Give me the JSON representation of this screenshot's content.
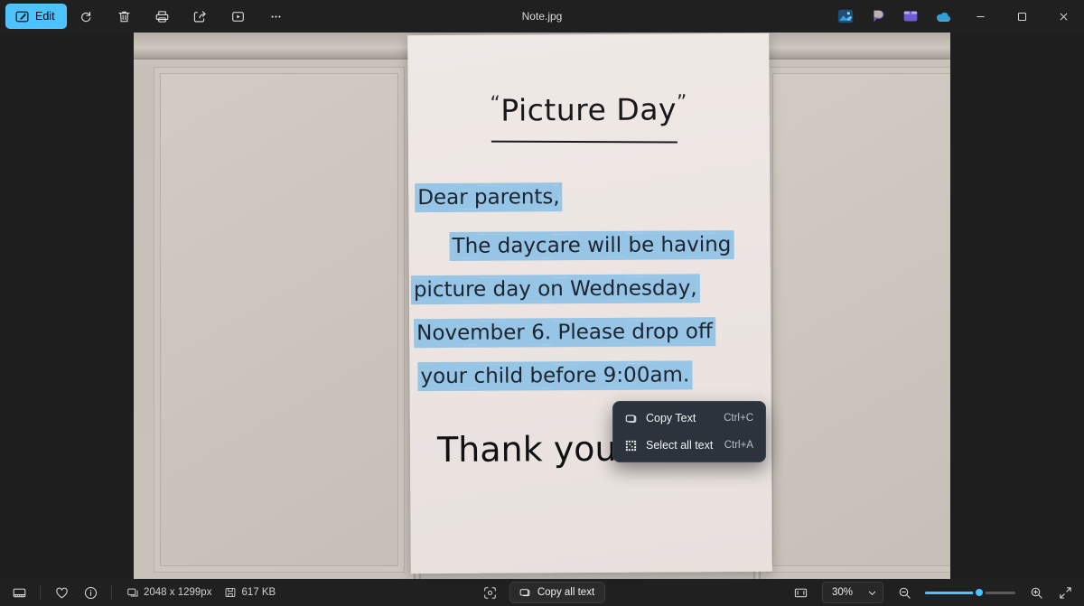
{
  "window": {
    "title": "Note.jpg"
  },
  "toolbar": {
    "edit_label": "Edit",
    "icons": [
      {
        "name": "rotate-icon",
        "tip": "Rotate"
      },
      {
        "name": "delete-icon",
        "tip": "Delete"
      },
      {
        "name": "print-icon",
        "tip": "Print"
      },
      {
        "name": "share-icon",
        "tip": "Share"
      },
      {
        "name": "slideshow-icon",
        "tip": "Slideshow"
      },
      {
        "name": "more-icon",
        "tip": "See more"
      }
    ],
    "apps": [
      {
        "name": "photos-edit-app-icon",
        "tip": "Edit in Photos"
      },
      {
        "name": "designer-app-icon",
        "tip": "Designer"
      },
      {
        "name": "clipchamp-app-icon",
        "tip": "Clipchamp"
      },
      {
        "name": "onedrive-app-icon",
        "tip": "OneDrive"
      }
    ],
    "window_controls": {
      "minimize": "–",
      "maximize": "☐",
      "close": "✕"
    }
  },
  "context_menu": {
    "items": [
      {
        "label": "Copy Text",
        "accel": "Ctrl+C",
        "icon": "copy-text-icon"
      },
      {
        "label": "Select all text",
        "accel": "Ctrl+A",
        "icon": "select-all-text-icon"
      }
    ]
  },
  "photo": {
    "note": {
      "title": "Picture Day",
      "quote_open": "“",
      "quote_close": "”",
      "lines": [
        {
          "text": "Dear parents,",
          "selected": true
        },
        {
          "text": "The daycare will be having",
          "selected": true
        },
        {
          "text": "picture day on Wednesday,",
          "selected": true
        },
        {
          "text": "November 6. Please drop off",
          "selected": true
        },
        {
          "text": "your child before 9:00am.",
          "selected": true
        },
        {
          "text": "Thank you!",
          "selected": false
        }
      ]
    }
  },
  "statusbar": {
    "filmstrip_tip": "Filmstrip",
    "favorite_tip": "Add to favorites",
    "info_tip": "File info",
    "dimensions": "2048 x 1299px",
    "filesize": "617 KB",
    "scan_text_tip": "Scan text",
    "copy_all_text": "Copy all text",
    "fit_tip": "Fit to window",
    "zoom_level": "30%",
    "zoom_out_tip": "Zoom out",
    "zoom_in_tip": "Zoom in",
    "fullscreen_tip": "Full screen",
    "slider_percent": 60
  },
  "colors": {
    "accent": "#4cc2ff",
    "window_bg": "#202020",
    "stage_bg": "#1e1e1e",
    "menu_bg": "#2c333c",
    "selection_highlight": "#96c5e6"
  }
}
